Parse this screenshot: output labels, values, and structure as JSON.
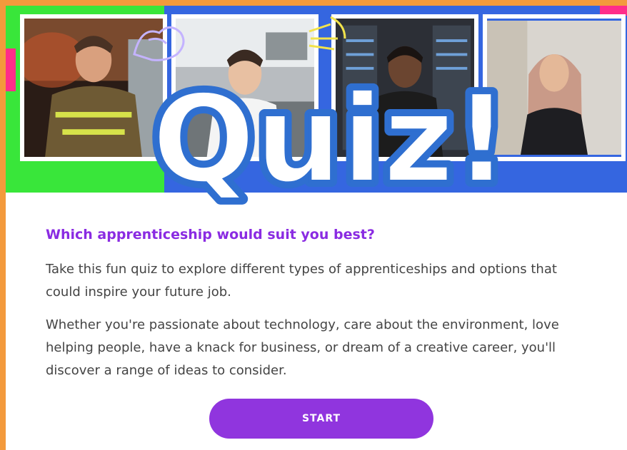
{
  "hero": {
    "title": "Quiz!",
    "photos": [
      {
        "icon": "firefighter-photo"
      },
      {
        "icon": "chef-photo"
      },
      {
        "icon": "technician-photo"
      },
      {
        "icon": "office-worker-photo"
      }
    ]
  },
  "main": {
    "subtitle": "Which apprenticeship would suit you best?",
    "paragraphs": [
      "Take this fun quiz to explore different types of apprenticeships and options that could inspire your future job.",
      "Whether you're passionate about technology, care about the environment, love helping people, have a knack for business, or dream of a creative career, you'll discover a range of ideas to consider."
    ],
    "start_label": "START"
  },
  "colors": {
    "frame": "#f39a3c",
    "accent_purple": "#9035de",
    "subtitle_purple": "#8a2be2",
    "hero_blue": "#3566e0",
    "hero_green": "#39e63a",
    "hero_pink": "#ff2d8a",
    "quiz_blue": "#2f6fd0"
  }
}
